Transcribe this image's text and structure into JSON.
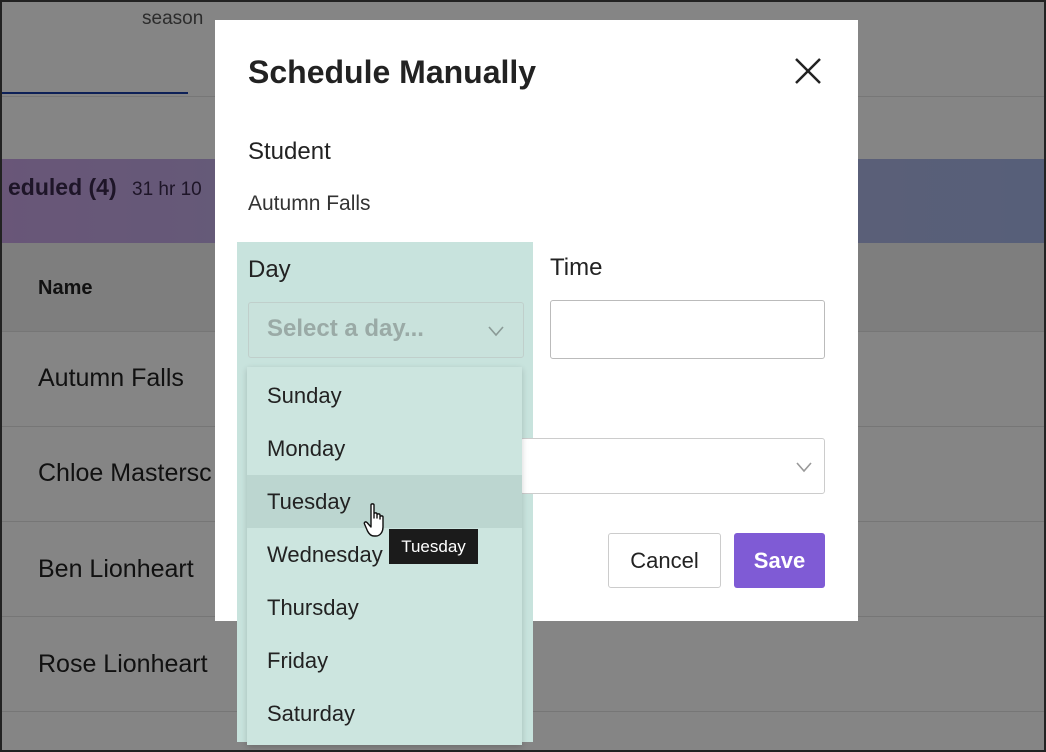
{
  "background": {
    "season_text": "season",
    "banner_title": "eduled (4)",
    "banner_subtitle": "31 hr 10",
    "column_name_header": "Name",
    "rows": [
      "Autumn Falls",
      "Chloe Mastersc",
      "Ben Lionheart",
      "Rose Lionheart"
    ]
  },
  "modal": {
    "title": "Schedule Manually",
    "close_icon": "close-icon",
    "student_label": "Student",
    "student_value": "Autumn Falls",
    "day_label": "Day",
    "day_placeholder": "Select a day...",
    "time_label": "Time",
    "time_value": "",
    "cancel_label": "Cancel",
    "save_label": "Save"
  },
  "dropdown": {
    "options": [
      "Sunday",
      "Monday",
      "Tuesday",
      "Wednesday",
      "Thursday",
      "Friday",
      "Saturday"
    ],
    "hovered": "Tuesday"
  },
  "tooltip": {
    "text": "Tuesday"
  },
  "colors": {
    "accent": "#7f5bd5",
    "dropdown_bg": "#cce5df",
    "overlay": "rgba(0,0,0,0.48)"
  }
}
